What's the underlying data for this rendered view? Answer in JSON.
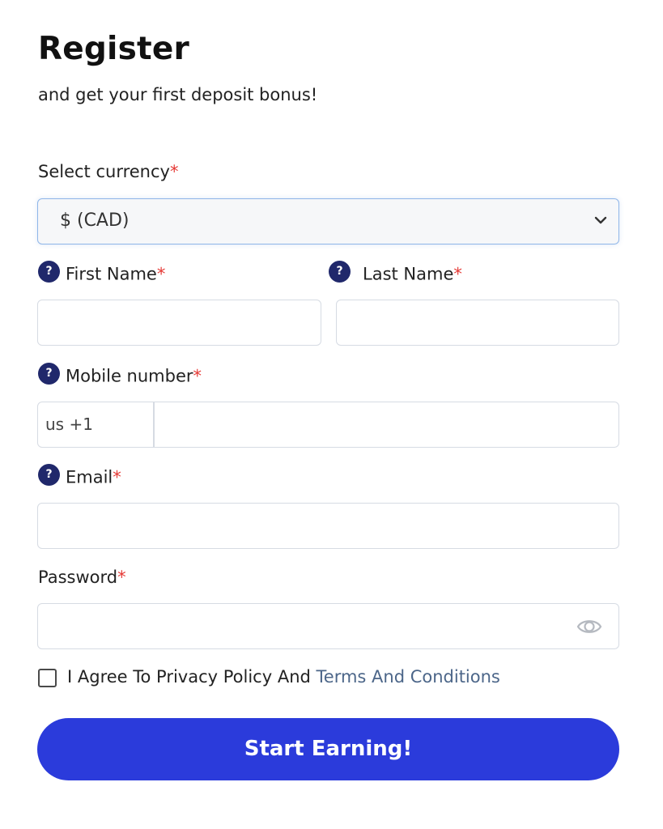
{
  "header": {
    "title": "Register",
    "subtitle": "and get your first deposit bonus!"
  },
  "required_marker": "*",
  "currency": {
    "label": "Select currency",
    "selected": "$ (CAD)"
  },
  "help_icon_glyph": "?",
  "first_name": {
    "label": "First Name",
    "value": ""
  },
  "last_name": {
    "label": "Last Name",
    "value": ""
  },
  "mobile": {
    "label": "Mobile number",
    "country_code": "us +1",
    "value": ""
  },
  "email": {
    "label": "Email",
    "value": ""
  },
  "password": {
    "label": "Password",
    "value": ""
  },
  "agreement": {
    "text": "I Agree To Privacy Policy And ",
    "link_text": "Terms And Conditions"
  },
  "submit_label": "Start Earning!",
  "colors": {
    "primary_button": "#2b3bdb",
    "required": "#e53935",
    "help_icon": "#20286b",
    "link": "#4c6689"
  },
  "icons": {
    "help": "question-circle-icon",
    "dropdown": "chevron-down-icon",
    "password_toggle": "eye-icon"
  }
}
